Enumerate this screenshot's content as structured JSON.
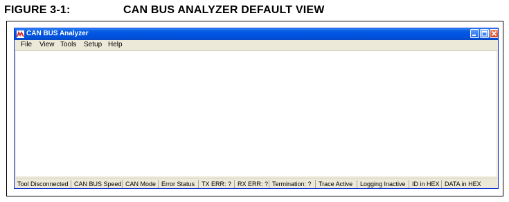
{
  "figure": {
    "number": "FIGURE 3-1:",
    "title": "CAN BUS ANALYZER DEFAULT VIEW"
  },
  "window": {
    "title": "CAN BUS Analyzer",
    "icon": "microchip-logo-icon",
    "controls": [
      "minimize-icon",
      "maximize-icon",
      "close-icon"
    ],
    "title_bar_color": "#0054e3",
    "close_button_color": "#d6401e"
  },
  "menu": {
    "items": [
      {
        "label": "File"
      },
      {
        "label": "View"
      },
      {
        "label": "Tools"
      },
      {
        "label": "Setup"
      },
      {
        "label": "Help"
      }
    ]
  },
  "status_bar": {
    "panels": [
      {
        "label": "Tool Disconnected"
      },
      {
        "label": "CAN BUS Speed"
      },
      {
        "label": "CAN Mode"
      },
      {
        "label": "Error Status"
      },
      {
        "label": "TX ERR: ?"
      },
      {
        "label": "RX ERR: ?"
      },
      {
        "label": "Termination: ?"
      },
      {
        "label": "Trace Active"
      },
      {
        "label": "Logging Inactive"
      },
      {
        "label": "ID in HEX"
      },
      {
        "label": "DATA in HEX"
      }
    ]
  }
}
